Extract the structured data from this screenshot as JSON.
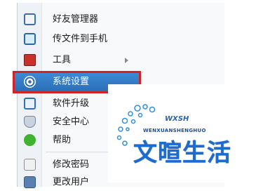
{
  "menu": {
    "items": [
      {
        "label": "好友管理器",
        "icon": "friends-icon"
      },
      {
        "label": "传文件到手机",
        "icon": "phone-icon"
      },
      {
        "label": "工具",
        "icon": "toolbox-icon",
        "submenu": true
      },
      {
        "label": "系统设置",
        "icon": "gear-icon",
        "selected": true
      },
      {
        "label": "软件升级",
        "icon": "upgrade-icon"
      },
      {
        "label": "安全中心",
        "icon": "shield-icon"
      },
      {
        "label": "帮助",
        "icon": "help-icon"
      },
      {
        "label": "修改密码",
        "icon": "lock-icon"
      },
      {
        "label": "更改用户",
        "icon": "user-icon"
      }
    ]
  },
  "watermark": {
    "small_text": "WXSH",
    "caption": "WENXUANSHENGHUO",
    "main_text": "文暄生活"
  },
  "colors": {
    "selected_bg": "#2a6fb7",
    "highlight_border": "#d32323",
    "logo_blue": "#1b6bd0"
  }
}
